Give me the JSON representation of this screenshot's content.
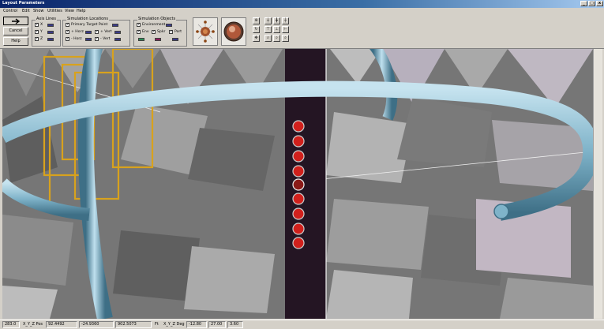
{
  "window": {
    "title": "Layout Parameters",
    "controls": {
      "minimize": "_",
      "maximize": "□",
      "close": "x"
    }
  },
  "menu": {
    "items": [
      "Control",
      "Edit",
      "Show",
      "Utilities",
      "View",
      "Help"
    ]
  },
  "toolbar": {
    "cancel_label": "Cancel",
    "help_label": "Help"
  },
  "axis_lines": {
    "title": "Axis Lines",
    "rows": [
      {
        "label": "X",
        "checked": true
      },
      {
        "label": "Y",
        "checked": true
      },
      {
        "label": "Z",
        "checked": true
      }
    ]
  },
  "simulation_locations": {
    "title": "Simulation Locations",
    "primary_target": {
      "label": "Primary Target Point",
      "checked": true
    },
    "rows": [
      {
        "label": "+ Horz",
        "checked": true
      },
      {
        "label": "+ Vert",
        "checked": true
      },
      {
        "label": "- Horz",
        "checked": true
      },
      {
        "label": "- Vert",
        "checked": true
      }
    ]
  },
  "simulation_objects": {
    "title": "Simulation Objects",
    "environment": {
      "label": "Environment",
      "checked": true
    },
    "rows": [
      {
        "label": "Env",
        "checked": true
      },
      {
        "label": "Spkr",
        "checked": true
      },
      {
        "label": "Port",
        "checked": true
      }
    ]
  },
  "colors": {
    "ring": "#7fb3c9",
    "frame": "#d8a21d",
    "column": "#241523",
    "speaker": "#d1201c",
    "wall_dark": "#6a6a6a",
    "wall_light": "#a7a7a7"
  },
  "status": {
    "field1": "283.0",
    "xyz_label": "X_Y_Z Pos",
    "x": "92.4492",
    "y": "-24.9360",
    "z": "902.5073",
    "unit": "Ft",
    "xyz_deg_label": "X_Y_Z Deg",
    "dx": "-12.80",
    "dy": "27.00",
    "dz": "3.60"
  }
}
